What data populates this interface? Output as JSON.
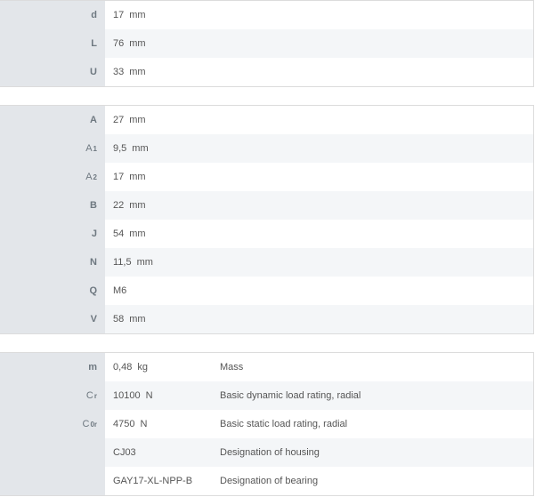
{
  "group1": [
    {
      "label": "d",
      "value": "17",
      "unit": "mm"
    },
    {
      "label": "L",
      "value": "76",
      "unit": "mm"
    },
    {
      "label": "U",
      "value": "33",
      "unit": "mm"
    }
  ],
  "group2": [
    {
      "label": "A",
      "sub": "",
      "value": "27",
      "unit": "mm"
    },
    {
      "label": "A",
      "sub": "1",
      "value": "9,5",
      "unit": "mm"
    },
    {
      "label": "A",
      "sub": "2",
      "value": "17",
      "unit": "mm"
    },
    {
      "label": "B",
      "sub": "",
      "value": "22",
      "unit": "mm"
    },
    {
      "label": "J",
      "sub": "",
      "value": "54",
      "unit": "mm"
    },
    {
      "label": "N",
      "sub": "",
      "value": "11,5",
      "unit": "mm"
    },
    {
      "label": "Q",
      "sub": "",
      "value": "M6",
      "unit": ""
    },
    {
      "label": "V",
      "sub": "",
      "value": "58",
      "unit": "mm"
    }
  ],
  "group3": [
    {
      "label": "m",
      "sub": "",
      "value": "0,48",
      "unit": "kg",
      "desc": "Mass"
    },
    {
      "label": "C",
      "sub": "r",
      "value": "10100",
      "unit": "N",
      "desc": "Basic dynamic load rating, radial"
    },
    {
      "label": "C",
      "sub": "0r",
      "value": "4750",
      "unit": "N",
      "desc": "Basic static load rating, radial"
    },
    {
      "label": "",
      "sub": "",
      "value": "CJ03",
      "unit": "",
      "desc": "Designation of housing"
    },
    {
      "label": "",
      "sub": "",
      "value": "GAY17-XL-NPP-B",
      "unit": "",
      "desc": "Designation of bearing"
    }
  ]
}
